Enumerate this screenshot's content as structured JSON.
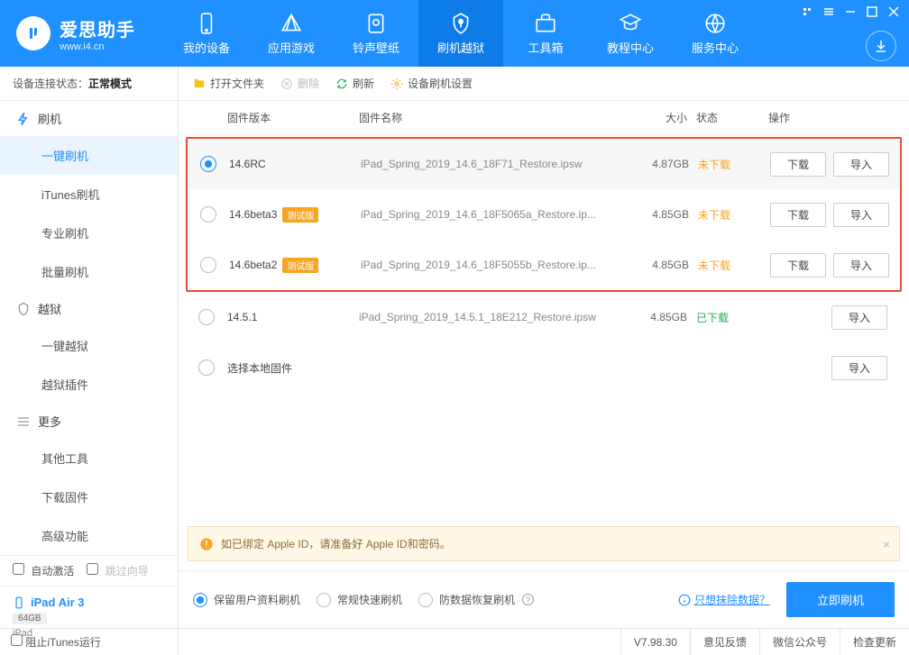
{
  "app": {
    "title": "爱思助手",
    "subtitle": "www.i4.cn"
  },
  "nav": {
    "items": [
      {
        "label": "我的设备"
      },
      {
        "label": "应用游戏"
      },
      {
        "label": "铃声壁纸"
      },
      {
        "label": "刷机越狱"
      },
      {
        "label": "工具箱"
      },
      {
        "label": "教程中心"
      },
      {
        "label": "服务中心"
      }
    ]
  },
  "sidebar": {
    "status_label": "设备连接状态：",
    "status_value": "正常模式",
    "groups": [
      {
        "header": "刷机",
        "items": [
          "一键刷机",
          "iTunes刷机",
          "专业刷机",
          "批量刷机"
        ]
      },
      {
        "header": "越狱",
        "items": [
          "一键越狱",
          "越狱插件"
        ]
      },
      {
        "header": "更多",
        "items": [
          "其他工具",
          "下载固件",
          "高级功能"
        ]
      }
    ],
    "auto_activate": "自动激活",
    "skip_guide": "跳过向导",
    "device": {
      "name": "iPad Air 3",
      "storage": "64GB",
      "type": "iPad"
    }
  },
  "toolbar": {
    "open_folder": "打开文件夹",
    "delete": "删除",
    "refresh": "刷新",
    "settings": "设备刷机设置"
  },
  "table": {
    "headers": {
      "version": "固件版本",
      "name": "固件名称",
      "size": "大小",
      "status": "状态",
      "action": "操作"
    },
    "rows": [
      {
        "version": "14.6RC",
        "beta": false,
        "name": "iPad_Spring_2019_14.6_18F71_Restore.ipsw",
        "size": "4.87GB",
        "status": "未下载",
        "status_class": "not",
        "selected": true,
        "actions": [
          "下载",
          "导入"
        ]
      },
      {
        "version": "14.6beta3",
        "beta": true,
        "name": "iPad_Spring_2019_14.6_18F5065a_Restore.ip...",
        "size": "4.85GB",
        "status": "未下载",
        "status_class": "not",
        "selected": false,
        "actions": [
          "下载",
          "导入"
        ]
      },
      {
        "version": "14.6beta2",
        "beta": true,
        "name": "iPad_Spring_2019_14.6_18F5055b_Restore.ip...",
        "size": "4.85GB",
        "status": "未下载",
        "status_class": "not",
        "selected": false,
        "actions": [
          "下载",
          "导入"
        ]
      },
      {
        "version": "14.5.1",
        "beta": false,
        "name": "iPad_Spring_2019_14.5.1_18E212_Restore.ipsw",
        "size": "4.85GB",
        "status": "已下载",
        "status_class": "done",
        "selected": false,
        "actions": [
          "",
          "导入"
        ]
      }
    ],
    "local_row": {
      "label": "选择本地固件",
      "action": "导入"
    },
    "beta_badge": "测试版"
  },
  "banner": {
    "text": "如已绑定 Apple ID，请准备好 Apple ID和密码。"
  },
  "flash": {
    "options": [
      "保留用户资料刷机",
      "常规快速刷机",
      "防数据恢复刷机"
    ],
    "erase_link": "只想抹除数据？",
    "button": "立即刷机"
  },
  "footer": {
    "block_itunes": "阻止iTunes运行",
    "version": "V7.98.30",
    "feedback": "意见反馈",
    "wechat": "微信公众号",
    "update": "检查更新"
  }
}
